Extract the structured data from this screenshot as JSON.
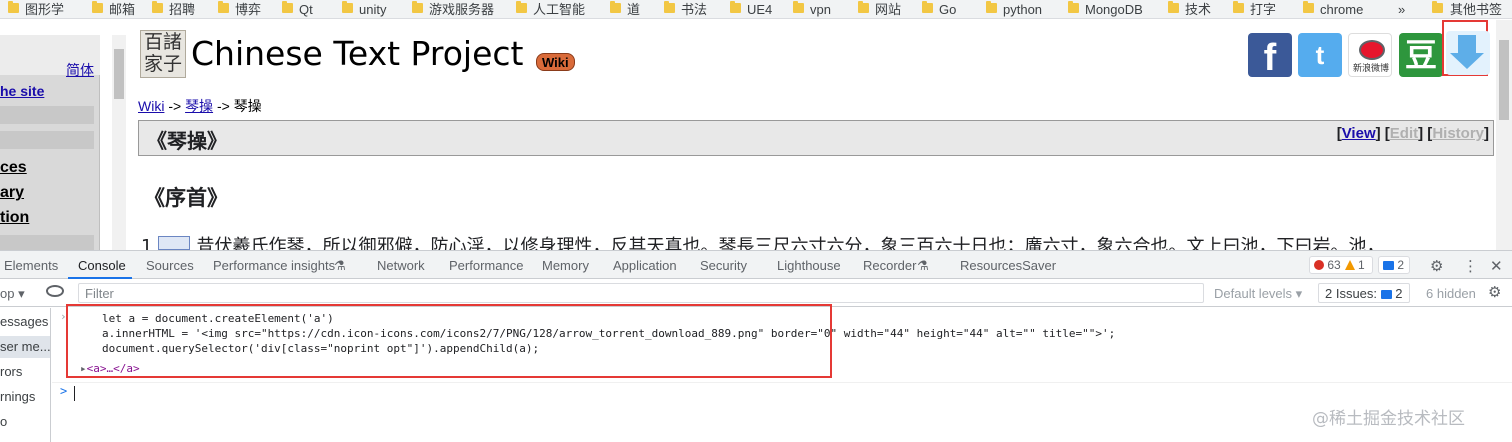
{
  "bookmarks": {
    "items": [
      "图形学",
      "邮箱",
      "招聘",
      "博弈",
      "Qt",
      "unity",
      "游戏服务器",
      "人工智能",
      "道",
      "书法",
      "UE4",
      "vpn",
      "网站",
      "Go",
      "python",
      "MongoDB",
      "技术",
      "打字",
      "chrome"
    ],
    "more": "»",
    "other": "其他书签"
  },
  "page": {
    "sidebar": {
      "trad_link": "简体",
      "site_link": "he site",
      "items": [
        "ces",
        "ary",
        "tion"
      ]
    },
    "logo_text": "百諸家子",
    "site_title": "Chinese Text Project",
    "wiki_badge": "Wiki",
    "social": {
      "facebook": "f",
      "twitter": "t",
      "weibo": "新浪微博",
      "douban": "豆"
    },
    "breadcrumb": {
      "root": "Wiki",
      "sep1": " -> ",
      "mid": "琴操",
      "sep2": " -> ",
      "current": "琴操"
    },
    "chapter_title": "《琴操》",
    "actions": {
      "view": "View",
      "edit": "Edit",
      "history": "History"
    },
    "section_title": "《序首》",
    "paragraph_num": "1",
    "paragraph_text": "昔伏羲氏作琴，所以御邪僻，防心淫，以修身理性，反其天真也。琴長三尺六寸六分，象三百六十日也；廣六寸，象六合也。文上曰池，下曰岩。池，"
  },
  "devtools": {
    "tabs": [
      "Elements",
      "Console",
      "Sources",
      "Performance insights",
      "Network",
      "Performance",
      "Memory",
      "Application",
      "Security",
      "Lighthouse",
      "Recorder",
      "ResourcesSaver"
    ],
    "active_tab": "Console",
    "errors": "63",
    "warnings": "1",
    "messages": "2",
    "toolbar": {
      "context": "op",
      "filter_placeholder": "Filter",
      "levels": "Default levels ▾",
      "issues": "2 Issues:",
      "issues_count": "2",
      "hidden": "6 hidden"
    },
    "side_items": [
      "essages",
      "ser me...",
      "rors",
      "rnings",
      "o"
    ],
    "code": [
      "let a = document.createElement('a')",
      "a.innerHTML = '<img src=\"https://cdn.icon-icons.com/icons2/7/PNG/128/arrow_torrent_download_889.png\" border=\"0\" width=\"44\" height=\"44\" alt=\"\" title=\"\">';",
      "document.querySelector('div[class=\"noprint opt\"]').appendChild(a);"
    ],
    "output": "<a>…</a>",
    "prompt": ">",
    "watermark": "@稀土掘金技术社区"
  }
}
